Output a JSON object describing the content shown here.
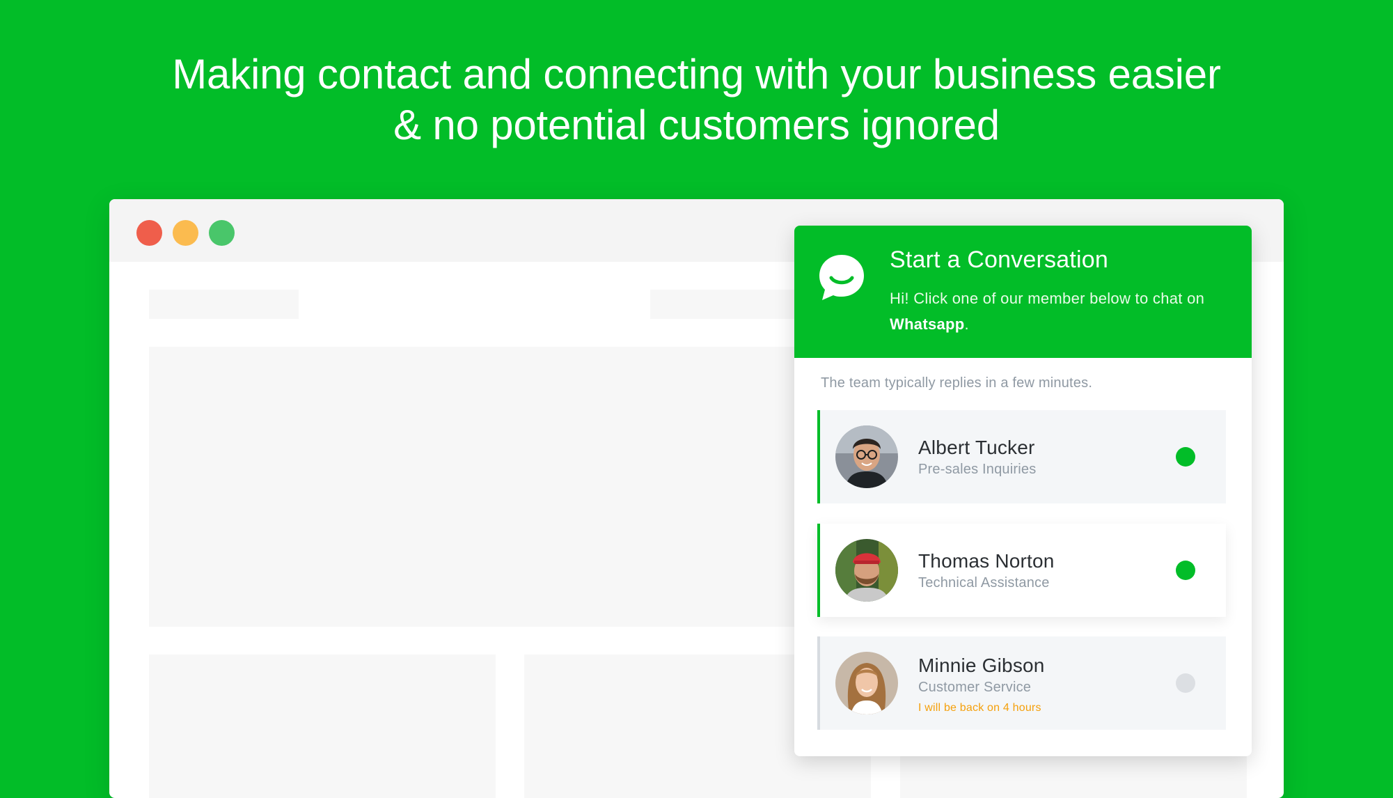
{
  "headline": {
    "line1": "Making contact and connecting with your business easier",
    "line2": "& no potential customers ignored"
  },
  "colors": {
    "brand_green": "#02bd28",
    "online": "#02bd28",
    "offline": "#dcdfe3",
    "away_text": "#f5a00b"
  },
  "browser": {
    "window_controls": [
      "close",
      "minimize",
      "maximize"
    ]
  },
  "widget": {
    "icon": "chat-bubble-smile-icon",
    "title": "Start a Conversation",
    "subtitle_prefix": "Hi! Click one of our member below to chat on",
    "subtitle_app": "Whatsapp",
    "subtitle_suffix": ".",
    "reply_note": "The team typically replies in a few minutes.",
    "members": [
      {
        "name": "Albert Tucker",
        "role": "Pre-sales Inquiries",
        "status": "online"
      },
      {
        "name": "Thomas Norton",
        "role": "Technical Assistance",
        "status": "online"
      },
      {
        "name": "Minnie Gibson",
        "role": "Customer Service",
        "status": "offline",
        "away_message": "I will be back on 4 hours"
      }
    ]
  }
}
